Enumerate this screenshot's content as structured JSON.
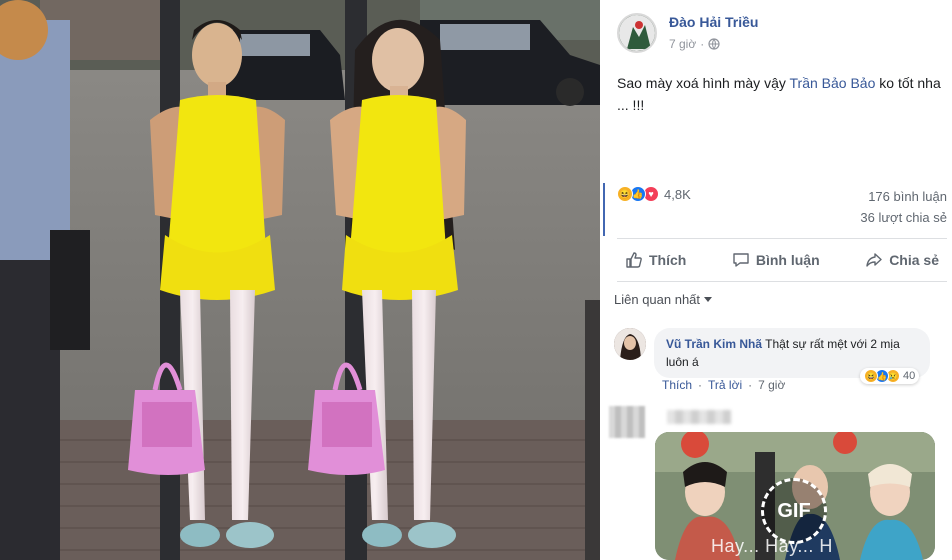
{
  "post": {
    "author": "Đào Hải Triều",
    "time": "7 giờ",
    "menu": "···",
    "text_before": "Sao mày xoá hình mày vậy ",
    "tag": "Trần Bảo Bảo",
    "text_after": " ko tốt nha ... !!!"
  },
  "stats": {
    "reaction_count": "4,8K",
    "comments": "176 bình luận",
    "shares": "36 lượt chia sẻ"
  },
  "actions": {
    "like": "Thích",
    "comment": "Bình luận",
    "share": "Chia sẻ"
  },
  "sort": {
    "label": "Liên quan nhất"
  },
  "comment1": {
    "name": "Vũ Trần Kim Nhã",
    "text": "Thật sự rất mệt với 2 mịa luôn á",
    "like": "Thích",
    "reply": "Trả lời",
    "time": "7 giờ",
    "reaction_count": "40"
  },
  "comment2": {
    "gif_badge": "GIF",
    "gif_caption": "Hay... Hay... H"
  },
  "colors": {
    "link": "#385898",
    "accent": "#4267b2",
    "dress": "#f2e60f",
    "bag": "#e18fd8"
  }
}
